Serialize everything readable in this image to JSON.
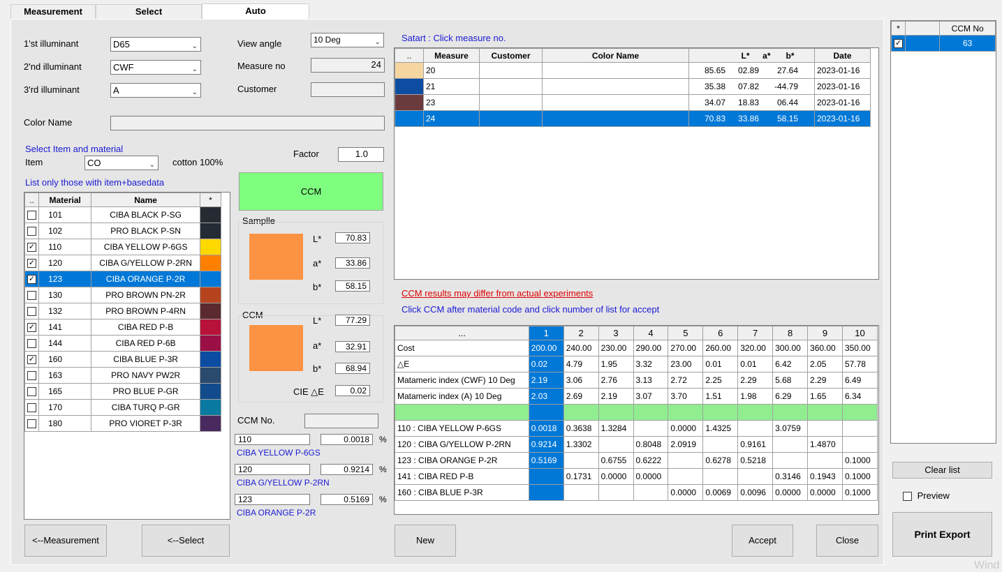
{
  "tabs": [
    "Measurement",
    "Select",
    "Auto"
  ],
  "illuminants": [
    {
      "label": "1'st illuminant",
      "value": "D65"
    },
    {
      "label": "2'nd illuminant",
      "value": "CWF"
    },
    {
      "label": "3'rd illuminant",
      "value": "A"
    }
  ],
  "view_angle": {
    "label": "View angle",
    "value": "10 Deg"
  },
  "measure_no": {
    "label": "Measure no",
    "value": "24"
  },
  "customer": {
    "label": "Customer",
    "value": ""
  },
  "color_name": {
    "label": "Color Name",
    "value": ""
  },
  "select_item_title": "Select Item and material",
  "item": {
    "label": "Item",
    "value": "CO",
    "desc": "cotton 100%"
  },
  "factor": {
    "label": "Factor",
    "value": "1.0"
  },
  "list_only_label": "List only those with item+basedata",
  "material_table": {
    "headers": [
      "..",
      "Material",
      "Name",
      "*"
    ],
    "rows": [
      {
        "checked": false,
        "code": "101",
        "name": "CIBA BLACK P-SG",
        "color": "#262b33",
        "selected": false
      },
      {
        "checked": false,
        "code": "102",
        "name": "PRO BLACK P-SN",
        "color": "#252b34",
        "selected": false
      },
      {
        "checked": true,
        "code": "110",
        "name": "CIBA YELLOW P-6GS",
        "color": "#ffd800",
        "selected": false
      },
      {
        "checked": true,
        "code": "120",
        "name": "CIBA G/YELLOW P-2RN",
        "color": "#ff8000",
        "selected": false
      },
      {
        "checked": true,
        "code": "123",
        "name": "CIBA ORANGE P-2R",
        "color": "#0078d7",
        "selected": true
      },
      {
        "checked": false,
        "code": "130",
        "name": "PRO BROWN PN-2R",
        "color": "#b5441e",
        "selected": false
      },
      {
        "checked": false,
        "code": "132",
        "name": "PRO BROWN P-4RN",
        "color": "#5a2a2e",
        "selected": false
      },
      {
        "checked": true,
        "code": "141",
        "name": "CIBA RED P-B",
        "color": "#b8123a",
        "selected": false
      },
      {
        "checked": false,
        "code": "144",
        "name": "CIBA RED P-6B",
        "color": "#9a0f45",
        "selected": false
      },
      {
        "checked": true,
        "code": "160",
        "name": "CIBA BLUE P-3R",
        "color": "#0c4da2",
        "selected": false
      },
      {
        "checked": false,
        "code": "163",
        "name": "PRO NAVY PW2R",
        "color": "#2a4a6e",
        "selected": false
      },
      {
        "checked": false,
        "code": "165",
        "name": "PRO BLUE P-GR",
        "color": "#124b8c",
        "selected": false
      },
      {
        "checked": false,
        "code": "170",
        "name": "CIBA TURQ P-GR",
        "color": "#0b7aa0",
        "selected": false
      },
      {
        "checked": false,
        "code": "180",
        "name": "PRO VIORET P-3R",
        "color": "#4a2a5e",
        "selected": false
      }
    ]
  },
  "ccm_button": "CCM",
  "sample": {
    "label": "Samplle",
    "color": "#fb9343",
    "L": "70.83",
    "a": "33.86",
    "b": "58.15"
  },
  "ccm": {
    "label": "CCM",
    "color": "#fb9343",
    "L": "77.29",
    "a": "32.91",
    "b": "68.94"
  },
  "lab_labels": {
    "L": "L*",
    "a": "a*",
    "b": "b*"
  },
  "cie_de": {
    "label": "CIE △E",
    "value": "0.02"
  },
  "ccm_no": {
    "label": "CCM No.",
    "value": ""
  },
  "recipe": [
    {
      "code": "110",
      "pct": "0.0018",
      "name": "CIBA YELLOW P-6GS"
    },
    {
      "code": "120",
      "pct": "0.9214",
      "name": "CIBA G/YELLOW P-2RN"
    },
    {
      "code": "123",
      "pct": "0.5169",
      "name": "CIBA ORANGE P-2R"
    }
  ],
  "pct_unit": "%",
  "buttons": {
    "measurement": "<--Measurement",
    "select": "<--Select",
    "new": "New",
    "accept": "Accept",
    "close": "Close",
    "clear_list": "Clear list",
    "print_export": "Print  Export"
  },
  "start_hint": "Satart : Click measure no.",
  "measure_table": {
    "headers": [
      "..",
      "Measure",
      "Customer",
      "Color Name",
      "L*",
      "a*",
      "b*",
      "Date"
    ],
    "rows": [
      {
        "color": "#f5d5a0",
        "measure": "20",
        "customer": "",
        "color_name": "",
        "L": "85.65",
        "a": "02.89",
        "b": "27.64",
        "date": "2023-01-16",
        "selected": false
      },
      {
        "color": "#0c4da2",
        "measure": "21",
        "customer": "",
        "color_name": "",
        "L": "35.38",
        "a": "07.82",
        "b": "-44.79",
        "date": "2023-01-16",
        "selected": false
      },
      {
        "color": "#6b3a3c",
        "measure": "23",
        "customer": "",
        "color_name": "",
        "L": "34.07",
        "a": "18.83",
        "b": "06.44",
        "date": "2023-01-16",
        "selected": false
      },
      {
        "color": "#0078d7",
        "measure": "24",
        "customer": "",
        "color_name": "",
        "L": "70.83",
        "a": "33.86",
        "b": "58.15",
        "date": "2023-01-16",
        "selected": true
      }
    ]
  },
  "warning_text": "CCM results may differ from actual experiments",
  "info_text": "Click CCM after material code and click number of list for accept",
  "results_table": {
    "headers": [
      "...",
      "1",
      "2",
      "3",
      "4",
      "5",
      "6",
      "7",
      "8",
      "9",
      "10"
    ],
    "rows": [
      {
        "label": "Cost",
        "vals": [
          "200.00",
          "240.00",
          "230.00",
          "290.00",
          "270.00",
          "260.00",
          "320.00",
          "300.00",
          "360.00",
          "350.00"
        ],
        "green": false
      },
      {
        "label": "△E",
        "vals": [
          "0.02",
          "4.79",
          "1.95",
          "3.32",
          "23.00",
          "0.01",
          "0.01",
          "6.42",
          "2.05",
          "57.78"
        ],
        "green": false
      },
      {
        "label": "Matameric index (CWF) 10 Deg",
        "vals": [
          "2.19",
          "3.06",
          "2.76",
          "3.13",
          "2.72",
          "2.25",
          "2.29",
          "5.68",
          "2.29",
          "6.49"
        ],
        "green": false
      },
      {
        "label": "Matameric index (A) 10 Deg",
        "vals": [
          "2.03",
          "2.69",
          "2.19",
          "3.07",
          "3.70",
          "1.51",
          "1.98",
          "6.29",
          "1.65",
          "6.34"
        ],
        "green": false
      },
      {
        "label": "",
        "vals": [
          "",
          "",
          "",
          "",
          "",
          "",
          "",
          "",
          "",
          ""
        ],
        "green": true
      },
      {
        "label": "110 : CIBA YELLOW P-6GS",
        "vals": [
          "0.0018",
          "0.3638",
          "1.3284",
          "",
          "0.0000",
          "1.4325",
          "",
          "3.0759",
          "",
          ""
        ],
        "green": false
      },
      {
        "label": "120 : CIBA G/YELLOW P-2RN",
        "vals": [
          "0.9214",
          "1.3302",
          "",
          "0.8048",
          "2.0919",
          "",
          "0.9161",
          "",
          "1.4870",
          ""
        ],
        "green": false
      },
      {
        "label": "123 : CIBA ORANGE P-2R",
        "vals": [
          "0.5169",
          "",
          "0.6755",
          "0.6222",
          "",
          "0.6278",
          "0.5218",
          "",
          "",
          "0.1000"
        ],
        "green": false
      },
      {
        "label": "141 : CIBA RED P-B",
        "vals": [
          "",
          "0.1731",
          "0.0000",
          "0.0000",
          "",
          "",
          "",
          "0.3146",
          "0.1943",
          "0.1000"
        ],
        "green": false
      },
      {
        "label": "160 : CIBA BLUE P-3R",
        "vals": [
          "",
          "",
          "",
          "",
          "0.0000",
          "0.0069",
          "0.0096",
          "0.0000",
          "0.0000",
          "0.1000"
        ],
        "green": false
      }
    ]
  },
  "ccm_list": {
    "headers": [
      "*",
      "",
      "CCM No"
    ],
    "rows": [
      {
        "checked": true,
        "no": "63"
      }
    ]
  },
  "preview": {
    "label": "Preview",
    "checked": false
  },
  "watermark": "Wind"
}
